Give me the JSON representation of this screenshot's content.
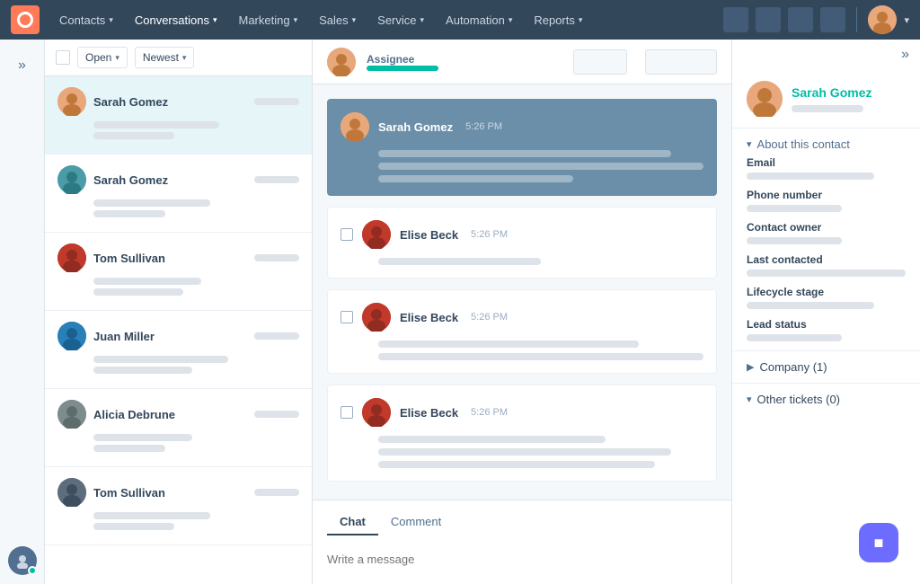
{
  "nav": {
    "items": [
      {
        "label": "Contacts",
        "id": "contacts"
      },
      {
        "label": "Conversations",
        "id": "conversations"
      },
      {
        "label": "Marketing",
        "id": "marketing"
      },
      {
        "label": "Sales",
        "id": "sales"
      },
      {
        "label": "Service",
        "id": "service"
      },
      {
        "label": "Automation",
        "id": "automation"
      },
      {
        "label": "Reports",
        "id": "reports"
      }
    ]
  },
  "conv_list": {
    "filter_open": "Open",
    "filter_newest": "Newest",
    "items": [
      {
        "name": "Sarah Gomez",
        "avatar_color": "orange",
        "active": true
      },
      {
        "name": "Sarah Gomez",
        "avatar_color": "teal",
        "active": false
      },
      {
        "name": "Tom Sullivan",
        "avatar_color": "red",
        "active": false
      },
      {
        "name": "Juan Miller",
        "avatar_color": "blue",
        "active": false
      },
      {
        "name": "Alicia Debrune",
        "avatar_color": "gray",
        "active": false
      },
      {
        "name": "Tom Sullivan",
        "avatar_color": "dark",
        "active": false
      }
    ]
  },
  "chat": {
    "assignee_label": "Assignee",
    "messages": [
      {
        "sender": "Sarah Gomez",
        "time": "5:26 PM",
        "type": "highlighted"
      },
      {
        "sender": "Elise Beck",
        "time": "5:26 PM",
        "type": "normal"
      },
      {
        "sender": "Elise Beck",
        "time": "5:26 PM",
        "type": "normal"
      },
      {
        "sender": "Elise Beck",
        "time": "5:26 PM",
        "type": "normal"
      }
    ],
    "tab_chat": "Chat",
    "tab_comment": "Comment",
    "input_placeholder": "Write a message"
  },
  "right_panel": {
    "contact_name": "Sarah Gomez",
    "about_label": "About this contact",
    "fields": [
      {
        "label": "Email",
        "bar_width": "medium"
      },
      {
        "label": "Phone number",
        "bar_width": "short"
      },
      {
        "label": "Contact owner",
        "bar_width": "short"
      },
      {
        "label": "Last contacted",
        "bar_width": "full"
      },
      {
        "label": "Lifecycle stage",
        "bar_width": "medium"
      },
      {
        "label": "Lead status",
        "bar_width": "short"
      }
    ],
    "company_label": "Company (1)",
    "tickets_label": "Other tickets (0)"
  }
}
